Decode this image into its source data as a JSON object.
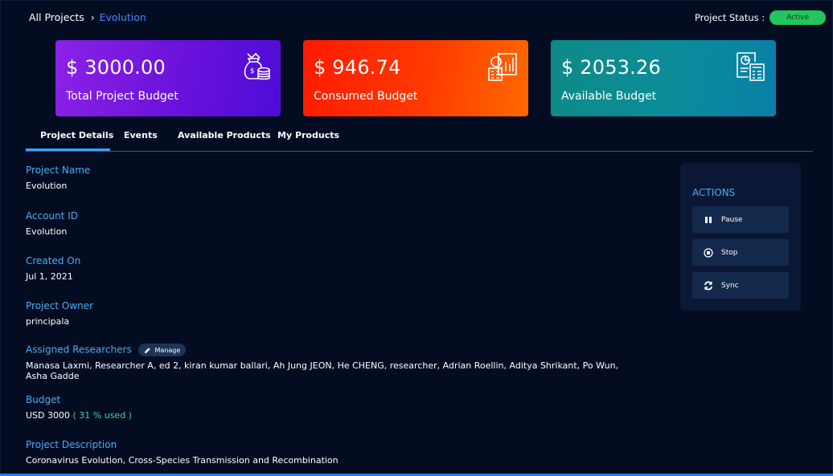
{
  "breadcrumb": {
    "root": "All Projects",
    "separator": "›",
    "current": "Evolution"
  },
  "status": {
    "label": "Project Status :",
    "value": "Active",
    "color": "#22c55e"
  },
  "cards": [
    {
      "amount": "$ 3000.00",
      "label": "Total Project Budget",
      "icon": "money-bag-icon"
    },
    {
      "amount": "$ 946.74",
      "label": "Consumed Budget",
      "icon": "calculator-chart-icon"
    },
    {
      "amount": "$ 2053.26",
      "label": "Available Budget",
      "icon": "report-calculator-icon"
    }
  ],
  "tabs": [
    {
      "label": "Project Details",
      "active": true
    },
    {
      "label": "Events",
      "active": false
    },
    {
      "label": "Available Products",
      "active": false
    },
    {
      "label": "My Products",
      "active": false
    }
  ],
  "details": {
    "project_name": {
      "label": "Project Name",
      "value": "Evolution"
    },
    "account_id": {
      "label": "Account ID",
      "value": "Evolution"
    },
    "created_on": {
      "label": "Created On",
      "value": "Jul 1, 2021"
    },
    "project_owner": {
      "label": "Project Owner",
      "value": "principala"
    },
    "assigned_researchers": {
      "label": "Assigned Researchers",
      "manage_label": "Manage",
      "value": "Manasa Laxmi, Researcher A, ed 2, kiran kumar ballari, Ah Jung JEON, He CHENG, researcher, Adrian Roellin, Aditya Shrikant, Po Wun, Asha Gadde"
    },
    "budget": {
      "label": "Budget",
      "value": "USD 3000",
      "used": "( 31 % used )"
    },
    "project_description": {
      "label": "Project Description",
      "value": "Coronavirus Evolution, Cross-Species Transmission and Recombination"
    }
  },
  "actions": {
    "title": "ACTIONS",
    "buttons": [
      {
        "label": "Pause",
        "icon": "pause-icon"
      },
      {
        "label": "Stop",
        "icon": "stop-icon"
      },
      {
        "label": "Sync",
        "icon": "sync-icon"
      }
    ]
  },
  "colors": {
    "accent": "#3ea0ff",
    "label_blue": "#4aaef2",
    "background": "#040c22"
  }
}
